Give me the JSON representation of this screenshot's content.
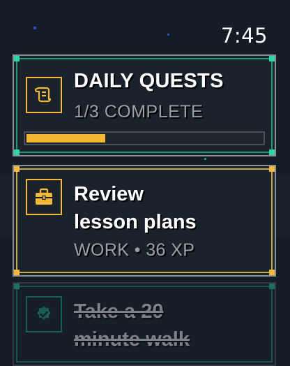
{
  "status_bar": {
    "time": "7:45"
  },
  "quest_summary": {
    "title": "DAILY QUESTS",
    "progress_text": "1/3 COMPLETE",
    "progress_fraction": 0.333,
    "icon": "scroll-icon",
    "accent": "#2fd5a3",
    "bar_color": "#f4b731"
  },
  "tasks": [
    {
      "title": "Review lesson plans",
      "title_line1": "Review",
      "title_line2": "lesson plans",
      "meta": "WORK • 36 XP",
      "icon": "briefcase-icon",
      "accent": "#f2b93b",
      "completed": false
    },
    {
      "title": "Take a 20 minute walk",
      "title_line1": "Take a 20",
      "title_line2": "minute walk",
      "icon": "verified-check-icon",
      "accent": "#2fd5a3",
      "completed": true
    }
  ]
}
